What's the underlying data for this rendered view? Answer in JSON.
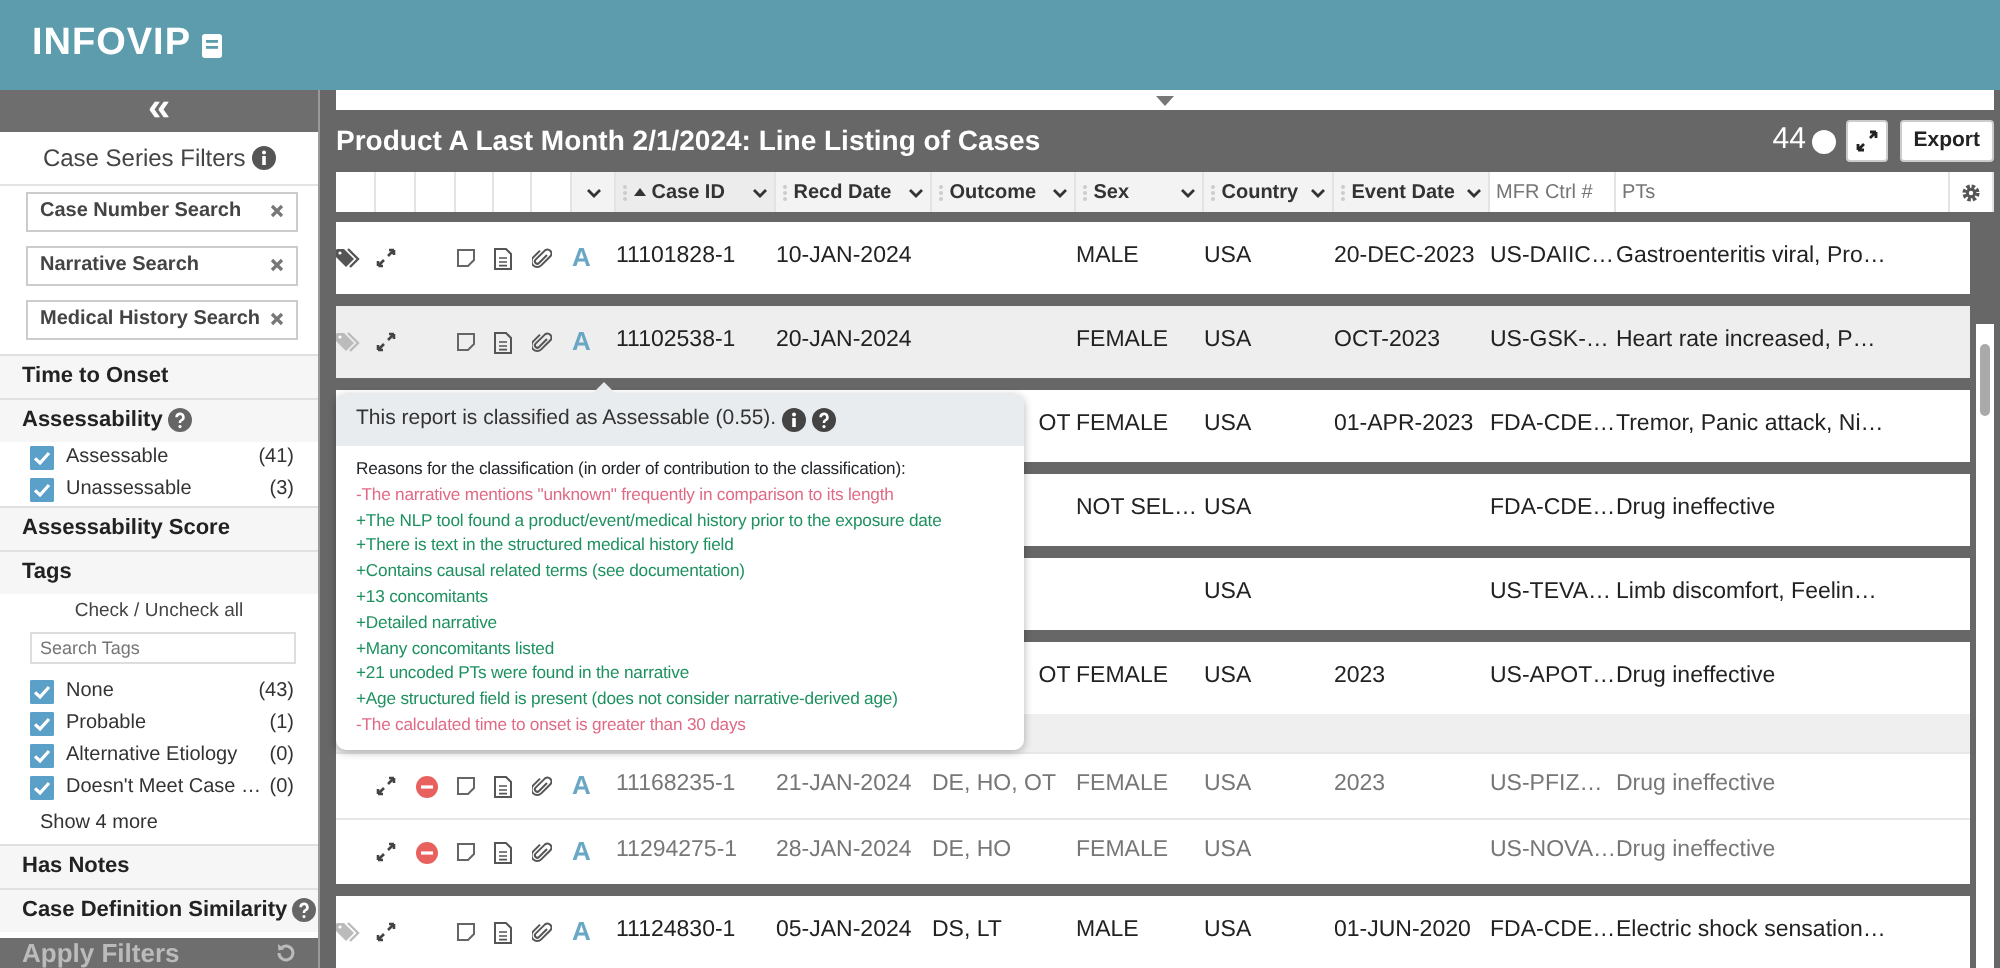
{
  "app": {
    "logo": "INFOVIP"
  },
  "sidebar": {
    "collapse": "«",
    "title": "Case Series Filters",
    "searches": [
      {
        "label": "Case Number Search"
      },
      {
        "label": "Narrative Search"
      },
      {
        "label": "Medical History Search"
      }
    ],
    "sections": [
      {
        "kind": "heading",
        "label": "Time to Onset"
      },
      {
        "kind": "heading",
        "label": "Assessability",
        "help": true
      },
      {
        "kind": "check",
        "label": "Assessable",
        "count": "(41)",
        "checked": true
      },
      {
        "kind": "check",
        "label": "Unassessable",
        "count": "(3)",
        "checked": true
      },
      {
        "kind": "heading",
        "label": "Assessability Score"
      },
      {
        "kind": "heading",
        "label": "Tags"
      },
      {
        "kind": "links",
        "check": "Check",
        "separator": "/",
        "uncheck": "Uncheck",
        "suffix": "all"
      },
      {
        "kind": "search",
        "placeholder": "Search Tags"
      },
      {
        "kind": "check",
        "label": "None",
        "count": "(43)",
        "checked": true
      },
      {
        "kind": "check",
        "label": "Probable",
        "count": "(1)",
        "checked": true
      },
      {
        "kind": "check",
        "label": "Alternative Etiology",
        "count": "(0)",
        "checked": true
      },
      {
        "kind": "check",
        "label": "Doesn't Meet Case …",
        "count": "(0)",
        "checked": true
      },
      {
        "kind": "more",
        "label": "Show 4 more"
      },
      {
        "kind": "heading",
        "label": "Has Notes"
      },
      {
        "kind": "heading",
        "label": "Case Definition Similarity",
        "help": true
      }
    ],
    "apply": "Apply Filters"
  },
  "listing": {
    "title": "Product A Last Month 2/1/2024: Line Listing of Cases",
    "count": "44",
    "export": "Export",
    "columns": [
      {
        "label": "Case ID",
        "kind": "dropdown",
        "sorted": true
      },
      {
        "label": "Recd Date",
        "kind": "dropdown",
        "sorted": false
      },
      {
        "label": "Outcome",
        "kind": "dropdown",
        "sorted": false
      },
      {
        "label": "Sex",
        "kind": "dropdown",
        "sorted": false
      },
      {
        "label": "Country",
        "kind": "dropdown",
        "sorted": false
      },
      {
        "label": "Event Date",
        "kind": "dropdown",
        "sorted": false
      },
      {
        "placeholder": "MFR Ctrl #",
        "kind": "filter"
      },
      {
        "placeholder": "PTs",
        "kind": "filter"
      }
    ],
    "rows": [
      {
        "tagged": true,
        "selected": false,
        "badge": "A",
        "case_id": "11101828-1",
        "recd_date": "10-JAN-2024",
        "sex": "MALE",
        "country": "USA",
        "event_date": "20-DEC-2023",
        "mfr": "US-DAIIC…",
        "pts": "Gastroenteritis viral, Pro…"
      },
      {
        "tagged": false,
        "selected": true,
        "badge": "A",
        "case_id": "11102538-1",
        "recd_date": "20-JAN-2024",
        "sex": "FEMALE",
        "country": "USA",
        "event_date": "OCT-2023",
        "mfr": "US-GSK-…",
        "pts": "Heart rate increased, P…"
      },
      {
        "outcome": "OT",
        "sex": "FEMALE",
        "country": "USA",
        "event_date": "01-APR-2023",
        "mfr": "FDA-CDE…",
        "pts": "Tremor, Panic attack, Ni…"
      },
      {
        "sex": "NOT SEL…",
        "country": "USA",
        "mfr": "FDA-CDE…",
        "pts": "Drug ineffective"
      },
      {
        "country": "USA",
        "mfr": "US-TEVA…",
        "pts": "Limb discomfort, Feelin…"
      },
      {
        "outcome": "OT",
        "sex": "FEMALE",
        "country": "USA",
        "event_date": "2023",
        "mfr": "US-APOT…",
        "pts": "Drug ineffective",
        "children": [
          {
            "badge": "A",
            "case_id": "11168235-1",
            "recd_date": "21-JAN-2024",
            "outcome": "DE, HO, OT",
            "sex": "FEMALE",
            "country": "USA",
            "event_date": "2023",
            "mfr": "US-PFIZ…",
            "pts": "Drug ineffective"
          },
          {
            "badge": "A",
            "case_id": "11294275-1",
            "recd_date": "28-JAN-2024",
            "outcome": "DE, HO",
            "sex": "FEMALE",
            "country": "USA",
            "mfr": "US-NOVA…",
            "pts": "Drug ineffective"
          }
        ]
      },
      {
        "tagged": false,
        "selected": false,
        "badge": "A",
        "case_id": "11124830-1",
        "recd_date": "05-JAN-2024",
        "outcome": "DS, LT",
        "sex": "MALE",
        "country": "USA",
        "event_date": "01-JUN-2020",
        "mfr": "FDA-CDE…",
        "pts": "Electric shock sensation…"
      }
    ]
  },
  "tooltip": {
    "title": "This report is classified as Assessable (0.55).",
    "intro": "Reasons for the classification (in order of contribution to the classification):",
    "reasons": [
      {
        "text": "-The narrative mentions \"unknown\" frequently in comparison to its length",
        "favorable": false
      },
      {
        "text": "+The NLP tool found a product/event/medical history prior to the exposure date",
        "favorable": true
      },
      {
        "text": "+There is text in the structured medical history field",
        "favorable": true
      },
      {
        "text": "+Contains causal related terms (see documentation)",
        "favorable": true
      },
      {
        "text": "+13 concomitants",
        "favorable": true
      },
      {
        "text": "+Detailed narrative",
        "favorable": true
      },
      {
        "text": "+Many concomitants listed",
        "favorable": true
      },
      {
        "text": "+21 uncoded PTs were found in the narrative",
        "favorable": true
      },
      {
        "text": "+Age structured field is present (does not consider narrative-derived age)",
        "favorable": true
      },
      {
        "text": "-The calculated time to onset is greater than 30 days",
        "favorable": false
      }
    ]
  }
}
